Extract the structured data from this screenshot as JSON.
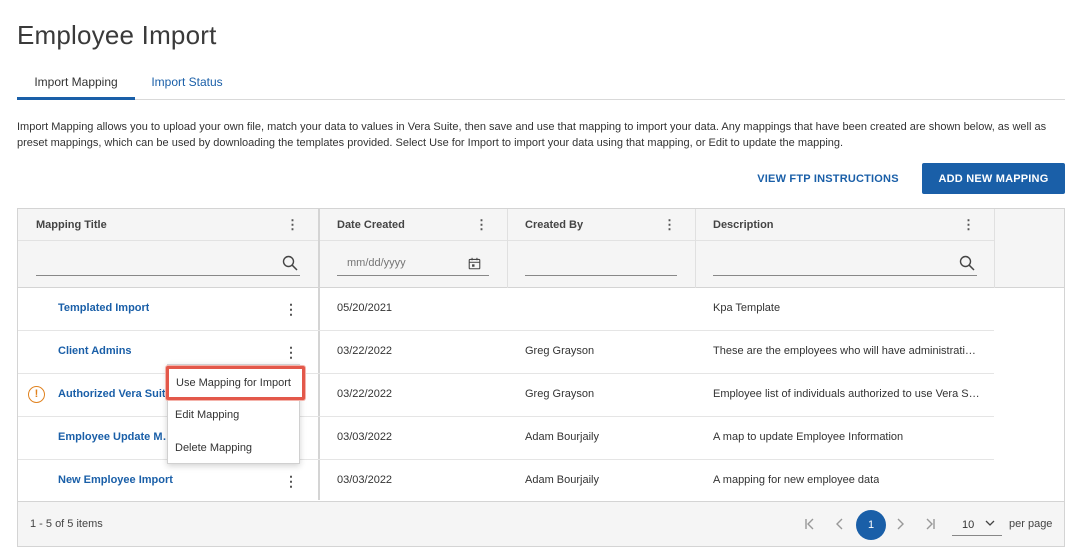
{
  "page": {
    "title": "Employee Import"
  },
  "tabs": [
    {
      "label": "Import Mapping",
      "active": true
    },
    {
      "label": "Import Status",
      "active": false
    }
  ],
  "intro": "Import Mapping allows you to upload your own file, match your data to values in Vera Suite, then save and use that mapping to import your data. Any mappings that have been created are shown below, as well as preset mappings, which can be used by downloading the templates provided. Select Use for Import to import your data using that mapping, or Edit to update the mapping.",
  "actions": {
    "ftp_label": "VIEW FTP INSTRUCTIONS",
    "add_label": "ADD NEW MAPPING"
  },
  "grid": {
    "columns": [
      "Mapping Title",
      "Date Created",
      "Created By",
      "Description"
    ],
    "date_placeholder": "mm/dd/yyyy",
    "rows": [
      {
        "title": "Templated Import",
        "date": "05/20/2021",
        "created_by": "",
        "description": "Kpa Template",
        "warning": false
      },
      {
        "title": "Client Admins",
        "date": "03/22/2022",
        "created_by": "Greg Grayson",
        "description": "These are the employees who will have administrati…",
        "warning": false
      },
      {
        "title": "Authorized Vera Suite",
        "date": "03/22/2022",
        "created_by": "Greg Grayson",
        "description": "Employee list of individuals authorized to use Vera S…",
        "warning": true
      },
      {
        "title": "Employee Update Mapping",
        "date": "03/03/2022",
        "created_by": "Adam Bourjaily",
        "description": "A map to update Employee Information",
        "warning": false
      },
      {
        "title": "New Employee Import",
        "date": "03/03/2022",
        "created_by": "Adam Bourjaily",
        "description": "A mapping for new employee data",
        "warning": false
      }
    ],
    "warning_glyph": "!",
    "footer": {
      "count": "1 - 5 of 5 items",
      "current_page": "1",
      "page_size": "10",
      "per_page_label": "per page"
    }
  },
  "context_menu": {
    "items": [
      "Use Mapping for Import",
      "Edit Mapping",
      "Delete Mapping"
    ]
  },
  "colors": {
    "accent": "#1a5fa8",
    "highlight_border": "#e3584a",
    "warning": "#e0821f"
  },
  "icons": [
    "search-icon",
    "calendar-icon",
    "kebab-icon",
    "warning-icon",
    "first-page-icon",
    "prev-page-icon",
    "next-page-icon",
    "last-page-icon",
    "chevron-down-icon"
  ]
}
